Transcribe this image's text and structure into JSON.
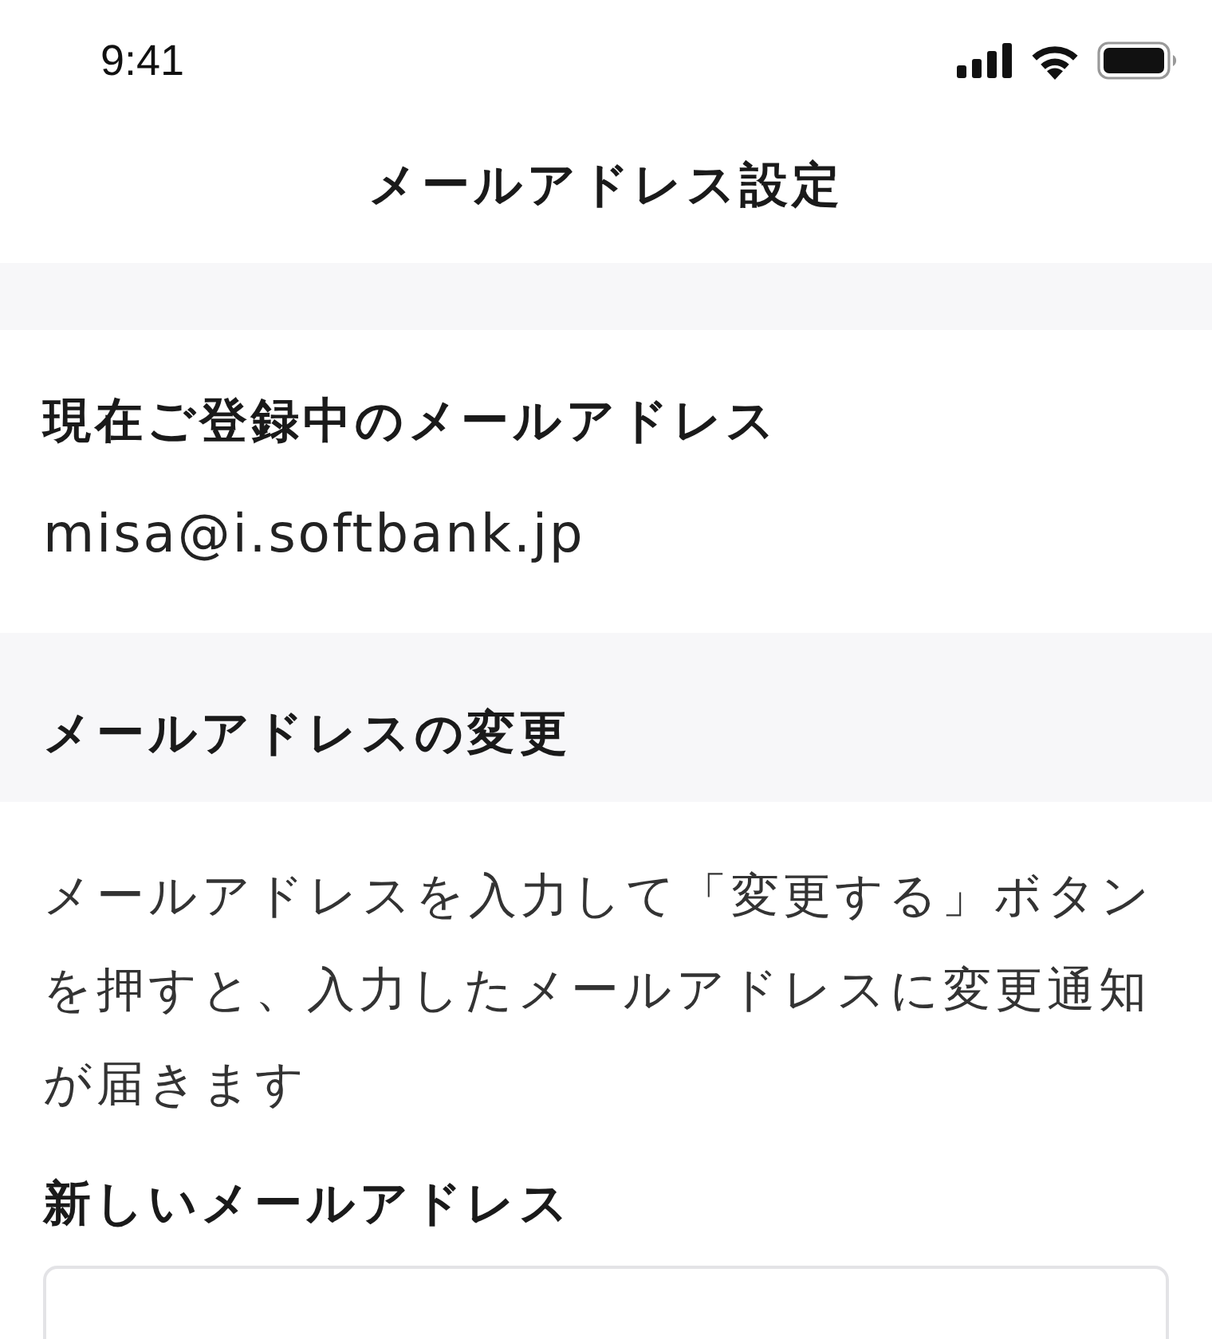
{
  "status_bar": {
    "time": "9:41"
  },
  "nav": {
    "title": "メールアドレス設定"
  },
  "current": {
    "heading": "現在ご登録中のメールアドレス",
    "email": "misa@i.softbank.jp"
  },
  "change": {
    "heading": "メールアドレスの変更",
    "description": "メールアドレスを入力して「変更する」ボタンを押すと、入力したメールアドレスに変更通知が届きます",
    "field": {
      "label": "新しいメールアドレス"
    }
  }
}
